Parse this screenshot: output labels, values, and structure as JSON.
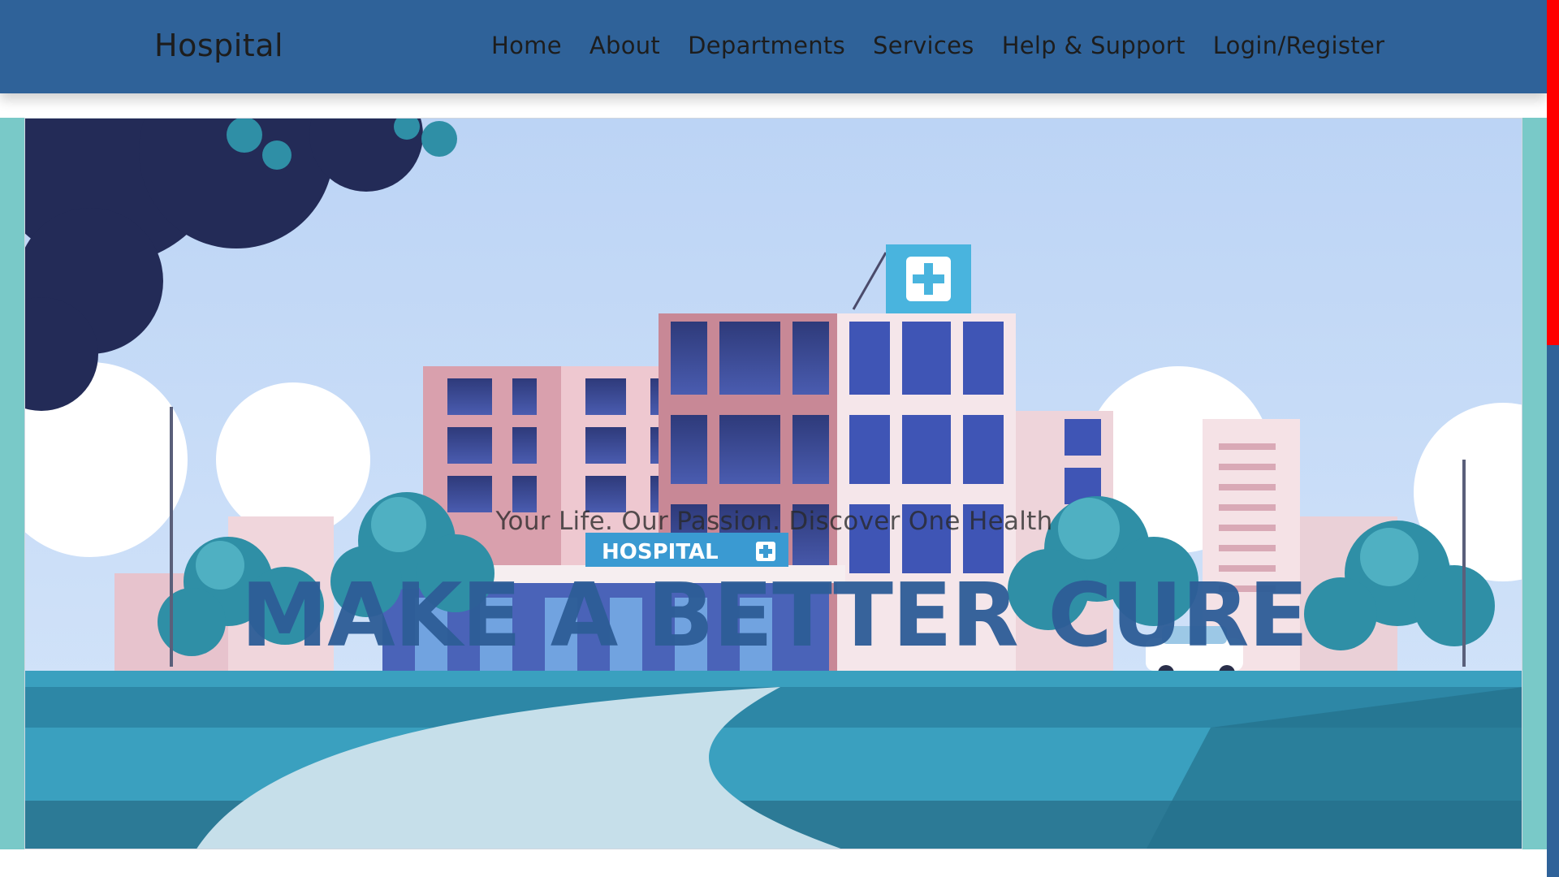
{
  "header": {
    "brand": "Hospital",
    "nav": [
      "Home",
      "About",
      "Departments",
      "Services",
      "Help & Support",
      "Login/Register"
    ]
  },
  "hero": {
    "tagline": "Your Life. Our Passion. Discover One Health",
    "headline": "MAKE A BETTER CURE",
    "sign_text": "HOSPITAL",
    "illustration": "hospital-building-illustration"
  },
  "colors": {
    "navbar": "#2f6299",
    "headline": "#2d5d97",
    "frame": "#79c9c8",
    "scroll_thumb": "#ff0000"
  }
}
